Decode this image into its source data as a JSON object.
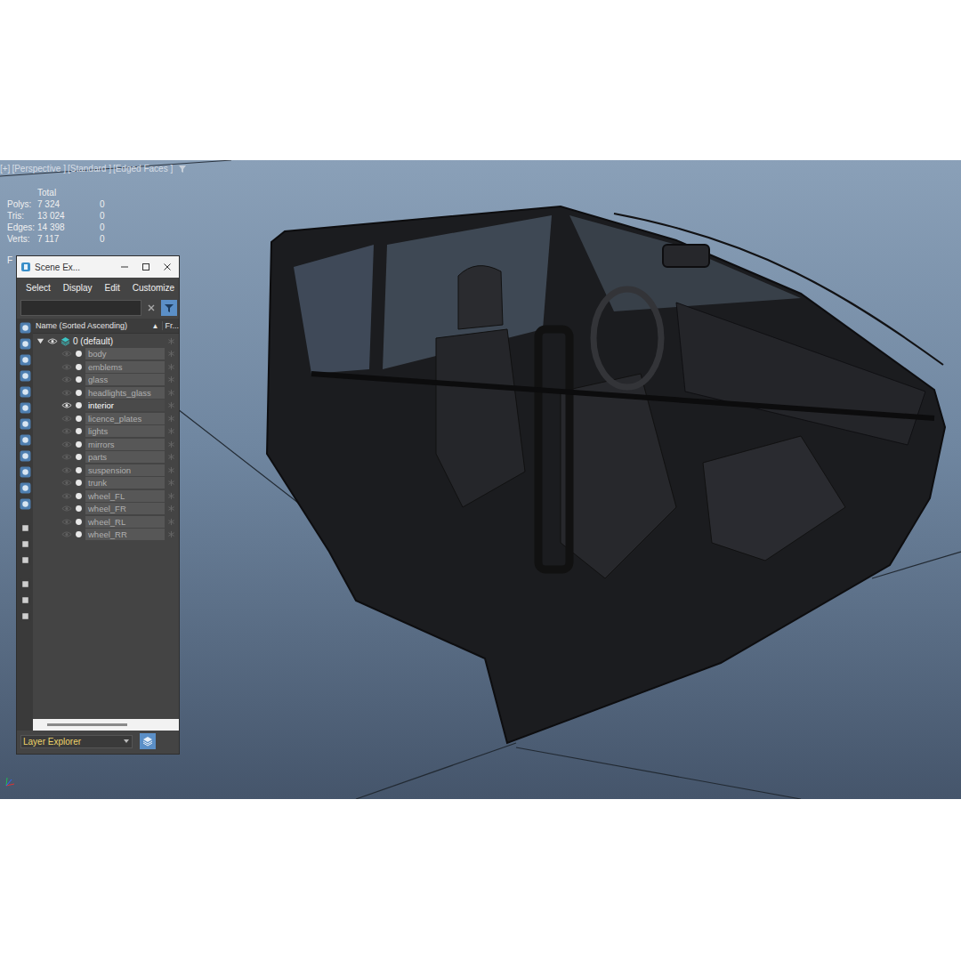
{
  "viewport": {
    "labels": [
      "[+]",
      "[Perspective ]",
      "[Standard ]",
      "[Edged Faces ]"
    ],
    "stats": {
      "header": "Total",
      "rows": [
        {
          "label": "Polys:",
          "total": "7 324",
          "selected": "0"
        },
        {
          "label": "Tris:",
          "total": "13 024",
          "selected": "0"
        },
        {
          "label": "Edges:",
          "total": "14 398",
          "selected": "0"
        },
        {
          "label": "Verts:",
          "total": "7 117",
          "selected": "0"
        }
      ]
    },
    "hidden_label": "F"
  },
  "explorer": {
    "title": "Scene Ex...",
    "menu": [
      "Select",
      "Display",
      "Edit",
      "Customize"
    ],
    "search": {
      "placeholder": ""
    },
    "columns": {
      "name": "Name (Sorted Ascending)",
      "sort": "▲",
      "frozen": "Fr..."
    },
    "root": {
      "name": "0 (default)",
      "expanded": true,
      "visible": true
    },
    "layers": [
      {
        "name": "body",
        "visible": false,
        "selected": false
      },
      {
        "name": "emblems",
        "visible": false,
        "selected": false
      },
      {
        "name": "glass",
        "visible": false,
        "selected": false
      },
      {
        "name": "headlights_glass",
        "visible": false,
        "selected": false
      },
      {
        "name": "interior",
        "visible": true,
        "selected": true
      },
      {
        "name": "licence_plates",
        "visible": false,
        "selected": false
      },
      {
        "name": "lights",
        "visible": false,
        "selected": false
      },
      {
        "name": "mirrors",
        "visible": false,
        "selected": false
      },
      {
        "name": "parts",
        "visible": false,
        "selected": false
      },
      {
        "name": "suspension",
        "visible": false,
        "selected": false
      },
      {
        "name": "trunk",
        "visible": false,
        "selected": false
      },
      {
        "name": "wheel_FL",
        "visible": false,
        "selected": false
      },
      {
        "name": "wheel_FR",
        "visible": false,
        "selected": false
      },
      {
        "name": "wheel_RL",
        "visible": false,
        "selected": false
      },
      {
        "name": "wheel_RR",
        "visible": false,
        "selected": false
      }
    ],
    "footer": "Layer Explorer"
  }
}
